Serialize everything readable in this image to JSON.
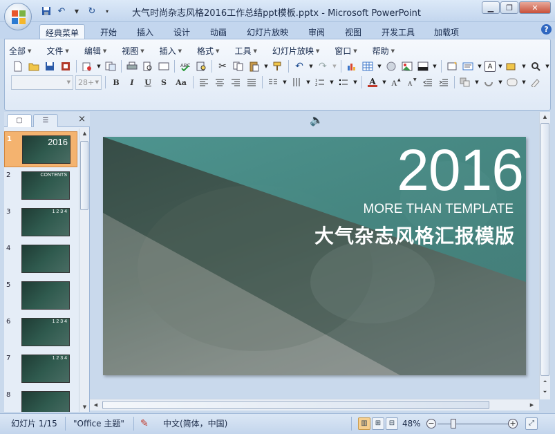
{
  "window": {
    "title": "大气时尚杂志风格2016工作总结ppt模板.pptx - Microsoft PowerPoint",
    "minimize_icon": "minimize-icon",
    "maximize_icon": "restore-icon",
    "close_icon": "close-icon"
  },
  "quick_access": {
    "save": "save-icon",
    "undo": "undo-icon",
    "redo": "redo-icon",
    "customize": "customize-qat-icon"
  },
  "ribbon_tabs": [
    "经典菜单",
    "开始",
    "插入",
    "设计",
    "动画",
    "幻灯片放映",
    "审阅",
    "视图",
    "开发工具",
    "加载项"
  ],
  "active_tab": "经典菜单",
  "menu": [
    "全部",
    "文件",
    "编辑",
    "视图",
    "插入",
    "格式",
    "工具",
    "幻灯片放映",
    "窗口",
    "帮助"
  ],
  "font": {
    "name": "",
    "size": "28+"
  },
  "text_style_buttons": {
    "bold": "B",
    "italic": "I",
    "underline": "U",
    "shadow": "S",
    "case": "Aa"
  },
  "font_color_label": "A",
  "slides_pane": {
    "tab_slides": "slides-tab-icon",
    "tab_outline": "outline-tab-icon",
    "close": "×",
    "thumbnails": [
      {
        "num": "1",
        "label": "2016"
      },
      {
        "num": "2",
        "label": "CONTENTS"
      },
      {
        "num": "3",
        "label": "1 2 3 4"
      },
      {
        "num": "4",
        "label": ""
      },
      {
        "num": "5",
        "label": ""
      },
      {
        "num": "6",
        "label": "1 2 3 4"
      },
      {
        "num": "7",
        "label": "1 2 3 4"
      },
      {
        "num": "8",
        "label": ""
      }
    ]
  },
  "slide": {
    "year": "2016",
    "subtitle_en": "MORE THAN TEMPLATE",
    "subtitle_cn": "大气杂志风格汇报模版"
  },
  "status": {
    "slide_counter": "幻灯片 1/15",
    "theme": "\"Office 主题\"",
    "language": "中文(简体，中国)",
    "zoom": "48%",
    "zoom_level": 0.48
  },
  "colors": {
    "accent": "#2f67c0",
    "selected_thumb": "#f4b36f",
    "slide_teal": "#3f8b86"
  }
}
